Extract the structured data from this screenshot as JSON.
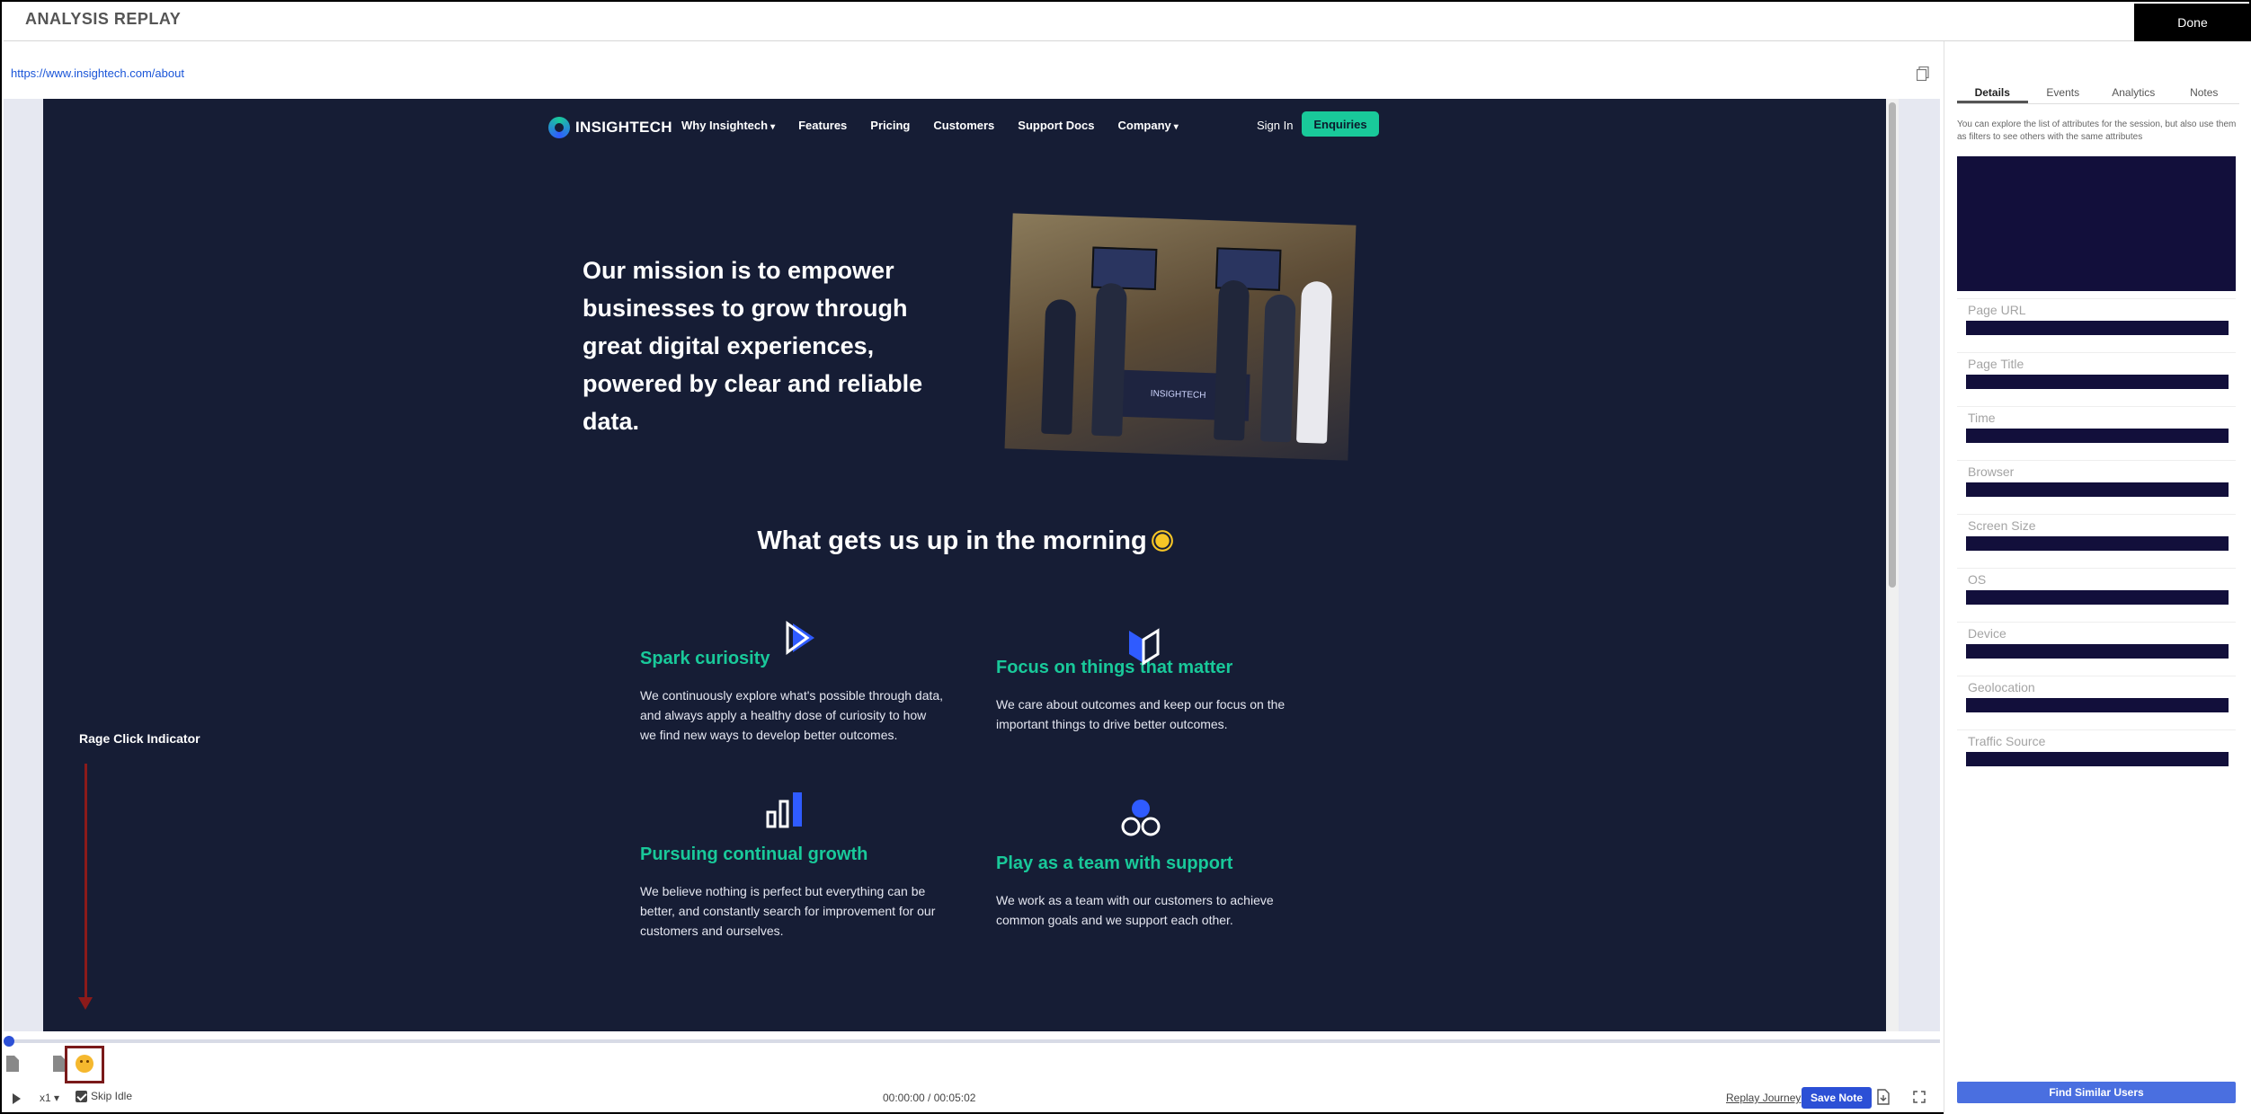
{
  "app": {
    "title": "ANALYSIS REPLAY",
    "done_label": "Done"
  },
  "url": "https://www.insightech.com/about",
  "site": {
    "logo_text": "INSIGHTECH",
    "nav": [
      {
        "label": "Why Insightech",
        "dropdown": true
      },
      {
        "label": "Features",
        "dropdown": false
      },
      {
        "label": "Pricing",
        "dropdown": false
      },
      {
        "label": "Customers",
        "dropdown": false
      },
      {
        "label": "Support Docs",
        "dropdown": false
      },
      {
        "label": "Company",
        "dropdown": true
      }
    ],
    "sign_in": "Sign In",
    "enquiries": "Enquiries",
    "mission": "Our mission is to empower businesses to grow through great digital experiences, powered by clear and reliable data.",
    "photo_banner": "INSIGHTECH",
    "morning_heading": "What gets us up in the morning",
    "features": [
      {
        "title": "Spark curiosity",
        "text": "We continuously explore what's possible through data, and always apply a healthy dose of curiosity to how we find new ways to develop better outcomes."
      },
      {
        "title": "Focus on things that matter",
        "text": "We care about outcomes and keep our focus on the important things to drive better outcomes."
      },
      {
        "title": "Pursuing continual growth",
        "text": "We believe nothing is perfect but everything can be better, and constantly search for improvement for our customers and ourselves."
      },
      {
        "title": "Play as a team with support",
        "text": "We work as a team with our customers to achieve common goals and we support each other."
      }
    ]
  },
  "annotation": {
    "rage_label": "Rage Click Indicator"
  },
  "controls": {
    "speed": "x1",
    "skip_idle": "Skip Idle",
    "time": "00:00:00 / 00:05:02",
    "replay_journey": "Replay Journey",
    "save_note": "Save Note"
  },
  "panel": {
    "tabs": [
      "Details",
      "Events",
      "Analytics",
      "Notes"
    ],
    "active_tab": "Details",
    "description": "You can explore the list of attributes for the session, but also use them as filters to see others with the same attributes",
    "attributes": [
      "Page URL",
      "Page Title",
      "Time",
      "Browser",
      "Screen Size",
      "OS",
      "Device",
      "Geolocation",
      "Traffic Source"
    ],
    "find_similar": "Find Similar Users"
  },
  "colors": {
    "site_bg": "#161d35",
    "accent_green": "#19c99a",
    "accent_blue": "#2c50d6",
    "redacted": "#120f3b"
  }
}
